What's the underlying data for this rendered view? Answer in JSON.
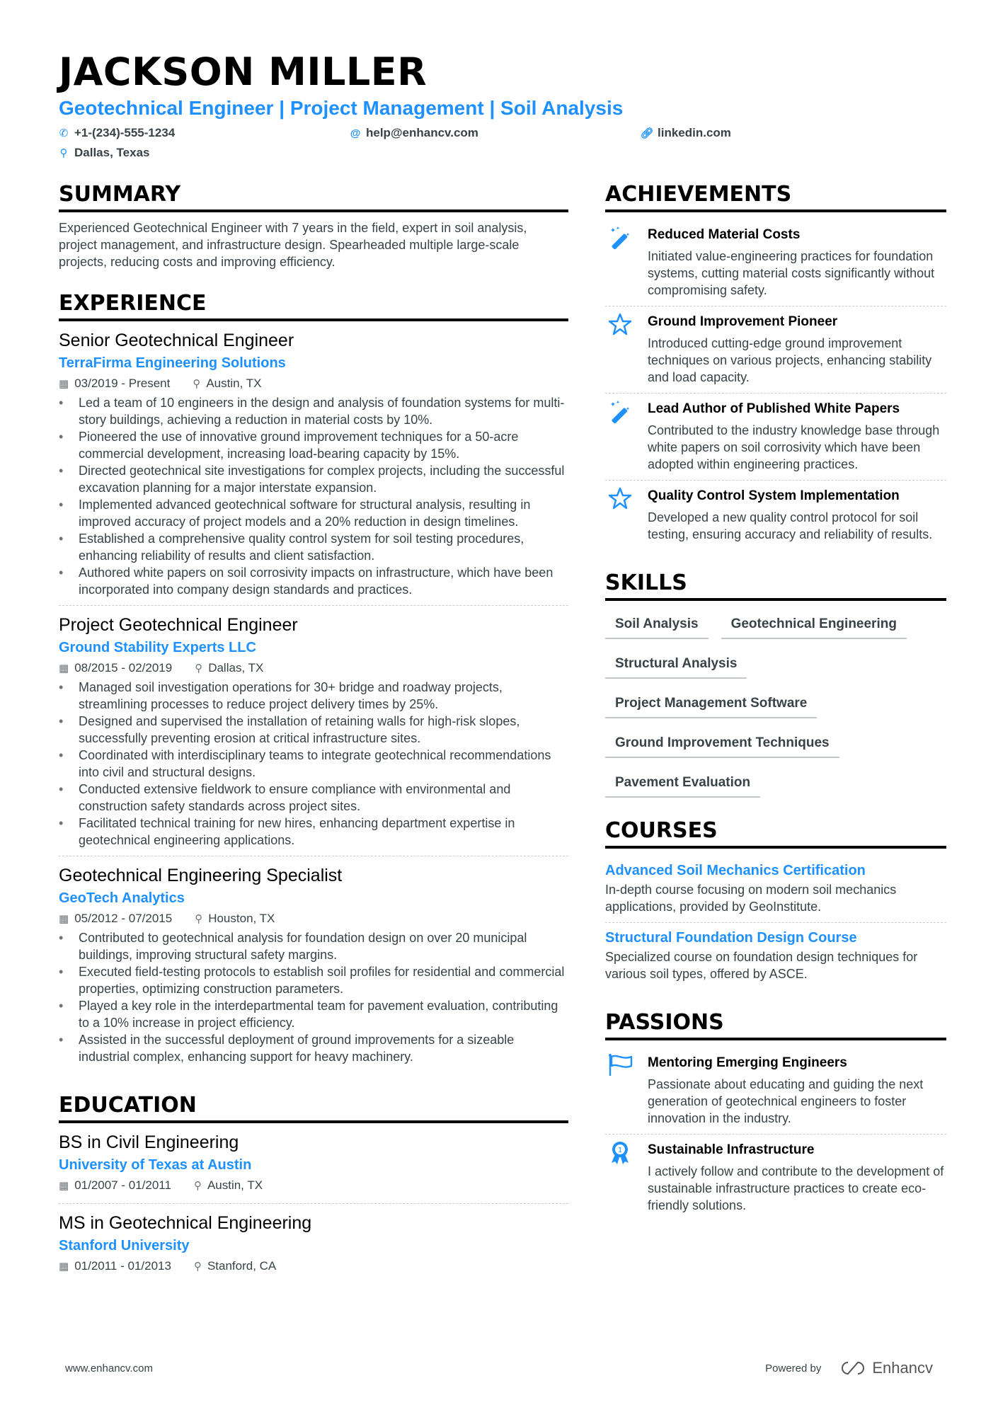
{
  "header": {
    "name": "JACKSON MILLER",
    "headline": "Geotechnical Engineer | Project Management | Soil Analysis",
    "phone": "+1-(234)-555-1234",
    "email": "help@enhancv.com",
    "link": "linkedin.com",
    "location": "Dallas, Texas"
  },
  "colors": {
    "accent": "#1e90ff",
    "text": "#384347",
    "heading": "#000000"
  },
  "summary": {
    "title": "SUMMARY",
    "text": "Experienced Geotechnical Engineer with 7 years in the field, expert in soil analysis, project management, and infrastructure design. Spearheaded multiple large-scale projects, reducing costs and improving efficiency."
  },
  "experience": {
    "title": "EXPERIENCE",
    "jobs": [
      {
        "title": "Senior Geotechnical Engineer",
        "company": "TerraFirma Engineering Solutions",
        "dates": "03/2019 - Present",
        "location": "Austin, TX",
        "bullets": [
          "Led a team of 10 engineers in the design and analysis of foundation systems for multi-story buildings, achieving a reduction in material costs by 10%.",
          "Pioneered the use of innovative ground improvement techniques for a 50-acre commercial development, increasing load-bearing capacity by 15%.",
          "Directed geotechnical site investigations for complex projects, including the successful excavation planning for a major interstate expansion.",
          "Implemented advanced geotechnical software for structural analysis, resulting in improved accuracy of project models and a 20% reduction in design timelines.",
          "Established a comprehensive quality control system for soil testing procedures, enhancing reliability of results and client satisfaction.",
          "Authored white papers on soil corrosivity impacts on infrastructure, which have been incorporated into company design standards and practices."
        ]
      },
      {
        "title": "Project Geotechnical Engineer",
        "company": "Ground Stability Experts LLC",
        "dates": "08/2015 - 02/2019",
        "location": "Dallas, TX",
        "bullets": [
          "Managed soil investigation operations for 30+ bridge and roadway projects, streamlining processes to reduce project delivery times by 25%.",
          "Designed and supervised the installation of retaining walls for high-risk slopes, successfully preventing erosion at critical infrastructure sites.",
          "Coordinated with interdisciplinary teams to integrate geotechnical recommendations into civil and structural designs.",
          "Conducted extensive fieldwork to ensure compliance with environmental and construction safety standards across project sites.",
          "Facilitated technical training for new hires, enhancing department expertise in geotechnical engineering applications."
        ]
      },
      {
        "title": "Geotechnical Engineering Specialist",
        "company": "GeoTech Analytics",
        "dates": "05/2012 - 07/2015",
        "location": "Houston, TX",
        "bullets": [
          "Contributed to geotechnical analysis for foundation design on over 20 municipal buildings, improving structural safety margins.",
          "Executed field-testing protocols to establish soil profiles for residential and commercial properties, optimizing construction parameters.",
          "Played a key role in the interdepartmental team for pavement evaluation, contributing to a 10% increase in project efficiency.",
          "Assisted in the successful deployment of ground improvements for a sizeable industrial complex, enhancing support for heavy machinery."
        ]
      }
    ]
  },
  "education": {
    "title": "EDUCATION",
    "items": [
      {
        "degree": "BS in Civil Engineering",
        "school": "University of Texas at Austin",
        "dates": "01/2007 - 01/2011",
        "location": "Austin, TX"
      },
      {
        "degree": "MS in Geotechnical Engineering",
        "school": "Stanford University",
        "dates": "01/2011 - 01/2013",
        "location": "Stanford, CA"
      }
    ]
  },
  "achievements": {
    "title": "ACHIEVEMENTS",
    "items": [
      {
        "icon": "magic-wand-icon",
        "title": "Reduced Material Costs",
        "desc": "Initiated value-engineering practices for foundation systems, cutting material costs significantly without compromising safety."
      },
      {
        "icon": "star-icon",
        "title": "Ground Improvement Pioneer",
        "desc": "Introduced cutting-edge ground improvement techniques on various projects, enhancing stability and load capacity."
      },
      {
        "icon": "magic-wand-icon",
        "title": "Lead Author of Published White Papers",
        "desc": "Contributed to the industry knowledge base through white papers on soil corrosivity which have been adopted within engineering practices."
      },
      {
        "icon": "star-icon",
        "title": "Quality Control System Implementation",
        "desc": "Developed a new quality control protocol for soil testing, ensuring accuracy and reliability of results."
      }
    ]
  },
  "skills": {
    "title": "SKILLS",
    "items": [
      "Soil Analysis",
      "Geotechnical Engineering",
      "Structural Analysis",
      "Project Management Software",
      "Ground Improvement Techniques",
      "Pavement Evaluation"
    ]
  },
  "courses": {
    "title": "COURSES",
    "items": [
      {
        "title": "Advanced Soil Mechanics Certification",
        "desc": "In-depth course focusing on modern soil mechanics applications, provided by GeoInstitute."
      },
      {
        "title": "Structural Foundation Design Course",
        "desc": "Specialized course on foundation design techniques for various soil types, offered by ASCE."
      }
    ]
  },
  "passions": {
    "title": "PASSIONS",
    "items": [
      {
        "icon": "flag-icon",
        "title": "Mentoring Emerging Engineers",
        "desc": "Passionate about educating and guiding the next generation of geotechnical engineers to foster innovation in the industry."
      },
      {
        "icon": "award-ribbon-icon",
        "title": "Sustainable Infrastructure",
        "desc": "I actively follow and contribute to the development of sustainable infrastructure practices to create eco-friendly solutions."
      }
    ]
  },
  "footer": {
    "website": "www.enhancv.com",
    "powered_by": "Powered by",
    "brand": "Enhancv"
  }
}
